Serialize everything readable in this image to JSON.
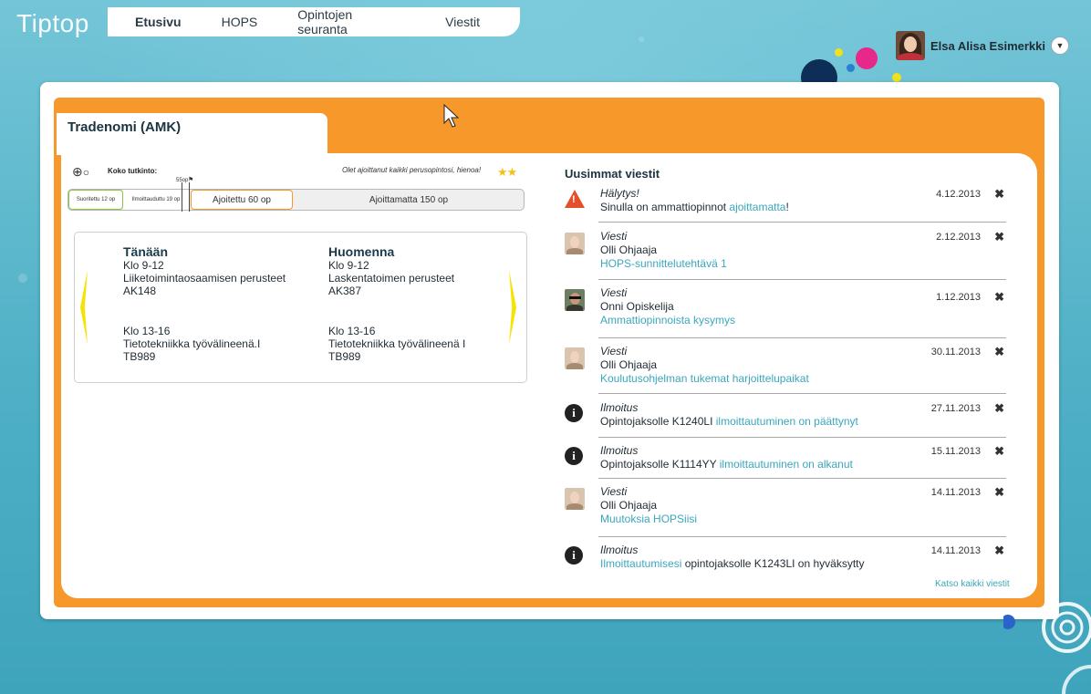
{
  "app": {
    "logo": "Tiptop"
  },
  "nav": {
    "tabs": [
      {
        "label": "Etusivu",
        "active": true
      },
      {
        "label": "HOPS",
        "active": false
      },
      {
        "label": "Opintojen seuranta",
        "active": false
      },
      {
        "label": "Viestit",
        "active": false
      }
    ]
  },
  "user": {
    "name": "Elsa Alisa Esimerkki",
    "menu_icon": "chevron-down-icon"
  },
  "degree": {
    "title": "Tradenomi (AMK)"
  },
  "progress": {
    "label": "Koko tutkinto:",
    "message": "Olet ajoittanut kaikki perusopintosi, hienoa!",
    "milestone": "55op",
    "segments": [
      {
        "label": "Suoritettu 12 op",
        "op": 12
      },
      {
        "label": "Ilmoittauduttu 19 op",
        "op": 19
      },
      {
        "label": "Ajoitettu 60 op",
        "op": 60
      },
      {
        "label": "Ajoittamatta 150 op",
        "op": 150
      }
    ]
  },
  "schedule": {
    "today": {
      "heading": "Tänään",
      "items": [
        {
          "time": "Klo 9-12",
          "course": "Liiketoimintaosaamisen perusteet",
          "room": "AK148"
        },
        {
          "time": "Klo 13-16",
          "course": "Tietotekniikka työvälineenä.I",
          "room": "TB989"
        }
      ]
    },
    "tomorrow": {
      "heading": "Huomenna",
      "items": [
        {
          "time": "Klo 9-12",
          "course": "Laskentatoimen perusteet",
          "room": "AK387"
        },
        {
          "time": "Klo 13-16",
          "course": "Tietotekniikka työvälineenä I",
          "room": "TB989"
        }
      ]
    }
  },
  "messages": {
    "title": "Uusimmat viestit",
    "see_all": "Katso kaikki viestit",
    "items": [
      {
        "type": "Hälytys!",
        "icon": "warning-icon",
        "line1_text": "Sinulla on ammattiopinnot ",
        "line1_link": "ajoittamatta",
        "line1_suffix": "!",
        "date": "4.12.2013"
      },
      {
        "type": "Viesti",
        "icon": "avatar-olli",
        "line1_text": "Olli Ohjaaja",
        "line2_link": "HOPS-sunnittelutehtävä 1",
        "date": "2.12.2013"
      },
      {
        "type": "Viesti",
        "icon": "avatar-onni",
        "line1_text": "Onni Opiskelija",
        "line2_link": "Ammattiopinnoista kysymys",
        "date": "1.12.2013"
      },
      {
        "type": "Viesti",
        "icon": "avatar-olli",
        "line1_text": "Olli Ohjaaja",
        "line2_link": "Koulutusohjelman tukemat harjoittelupaikat",
        "date": "30.11.2013"
      },
      {
        "type": "Ilmoitus",
        "icon": "info-icon",
        "line1_text": "Opintojaksolle K1240LI ",
        "line1_link": "ilmoittautuminen on päättynyt",
        "date": "27.11.2013"
      },
      {
        "type": "Ilmoitus",
        "icon": "info-icon",
        "line1_text": "Opintojaksolle K1114YY ",
        "line1_link": "ilmoittautuminen on alkanut",
        "date": "15.11.2013"
      },
      {
        "type": "Viesti",
        "icon": "avatar-olli",
        "line1_text": "Olli Ohjaaja",
        "line2_link": "Muutoksia HOPSiisi",
        "date": "14.11.2013"
      },
      {
        "type": "Ilmoitus",
        "icon": "info-icon",
        "line1_link": "Ilmoittautumisesi",
        "line1_suffix": " opintojaksolle K1243LI on hyväksytty",
        "date": "14.11.2013"
      }
    ]
  },
  "colors": {
    "accent": "#f7982a",
    "link": "#3aa7bd",
    "background": "#5eb8cc"
  }
}
